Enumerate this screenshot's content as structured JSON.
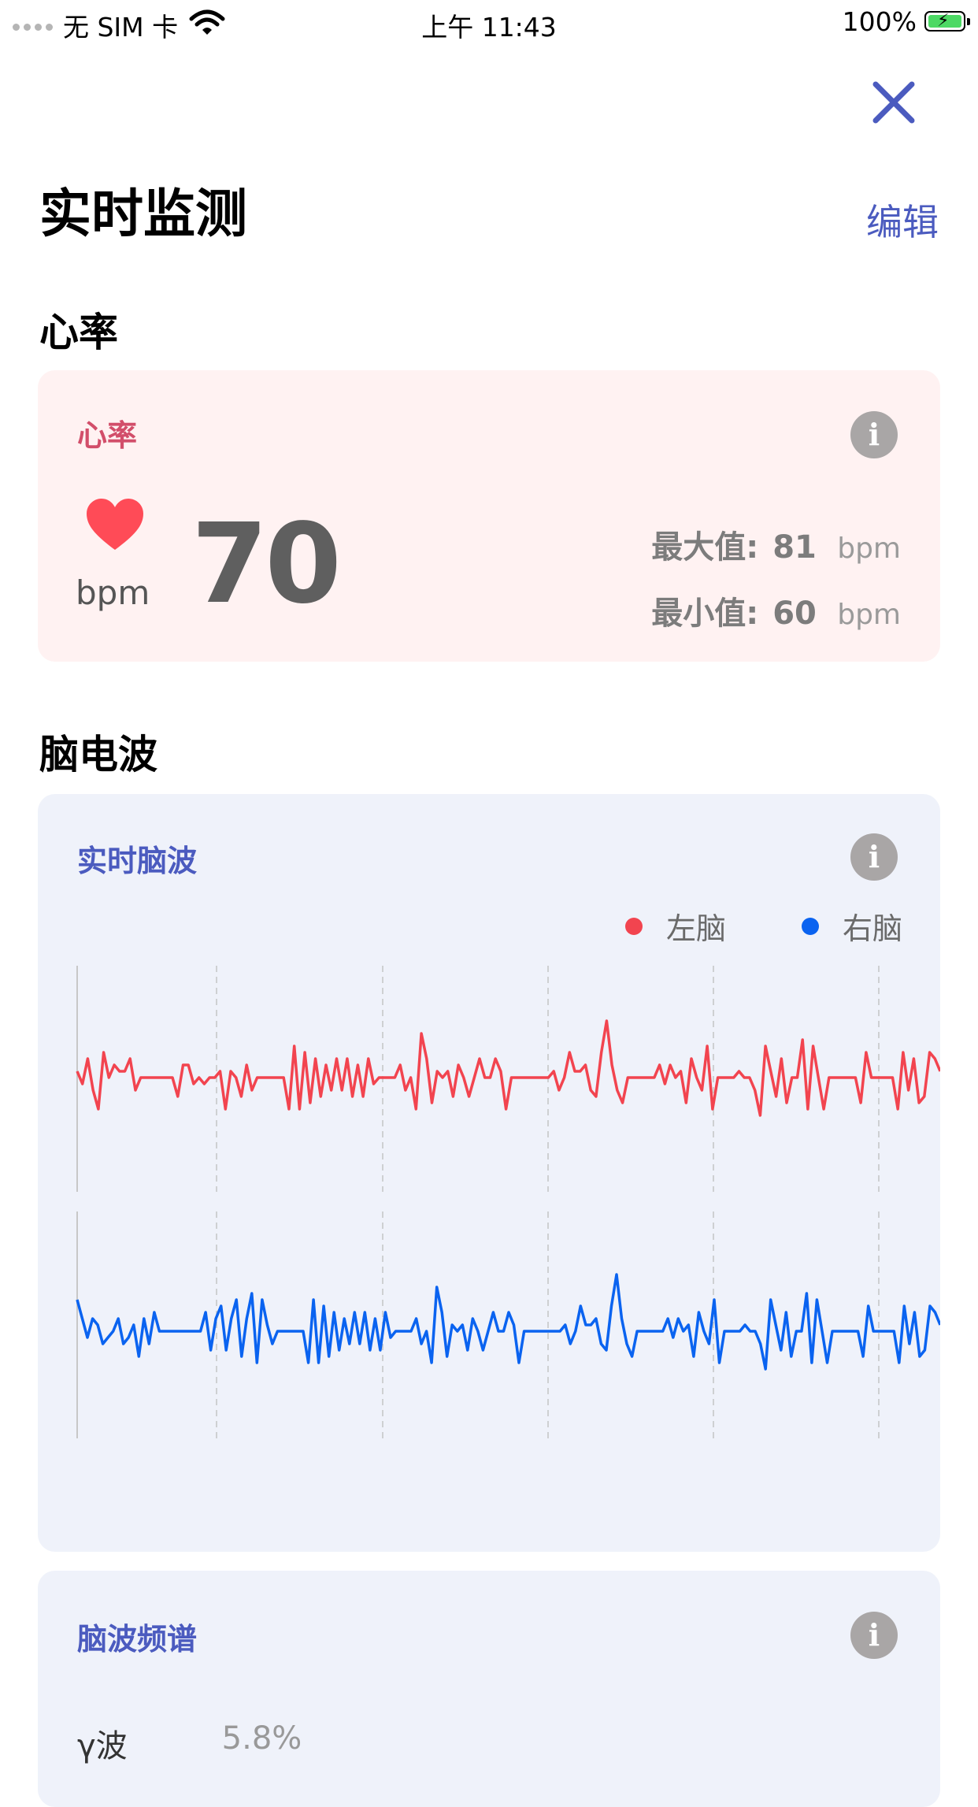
{
  "status_bar": {
    "carrier": "无 SIM 卡",
    "time": "上午 11:43",
    "battery": "100%"
  },
  "page": {
    "title": "实时监测",
    "edit_label": "编辑"
  },
  "heart_rate": {
    "section_title": "心率",
    "card_title": "心率",
    "value": "70",
    "unit": "bpm",
    "max_label": "最大值:",
    "max_value": "81",
    "max_unit": "bpm",
    "min_label": "最小值:",
    "min_value": "60",
    "min_unit": "bpm",
    "accent_color": "#d24e6a",
    "heart_color": "#ff4b57"
  },
  "eeg": {
    "section_title": "脑电波",
    "card_title": "实时脑波",
    "legend": [
      {
        "label": "左脑",
        "color": "#f2444f"
      },
      {
        "label": "右脑",
        "color": "#0a63f0"
      }
    ],
    "title_color": "#4b5bbf"
  },
  "spectrum": {
    "card_title": "脑波频谱",
    "first_row_label": "γ波",
    "first_row_value": "5.8%"
  },
  "chart_data": {
    "type": "line",
    "title": "实时脑波",
    "grid": true,
    "series": [
      {
        "name": "左脑",
        "color": "#f2444f",
        "values": [
          0.1,
          -0.1,
          0.3,
          -0.2,
          -0.5,
          0.4,
          0,
          0.2,
          0.1,
          0.1,
          0.3,
          -0.2,
          0,
          0,
          0,
          0,
          0,
          0,
          0,
          -0.3,
          0.2,
          0.2,
          -0.1,
          0,
          -0.1,
          0,
          0,
          0.1,
          -0.5,
          0.1,
          0,
          -0.3,
          0.2,
          -0.2,
          0,
          0,
          0,
          0,
          0,
          0,
          -0.5,
          0.5,
          -0.5,
          0.4,
          -0.4,
          0.3,
          -0.3,
          0.2,
          -0.2,
          0.3,
          -0.2,
          0.3,
          -0.3,
          0.2,
          -0.3,
          0.3,
          -0.1,
          0,
          0,
          0,
          0,
          0.2,
          -0.2,
          0,
          -0.5,
          0.7,
          0.3,
          -0.4,
          0.1,
          0,
          0.1,
          -0.3,
          0.2,
          0,
          -0.3,
          0,
          0.3,
          0,
          0,
          0.3,
          0.1,
          -0.5,
          0,
          0,
          0,
          0,
          0,
          0,
          0,
          0,
          0.1,
          -0.2,
          0,
          0.4,
          0.1,
          0.1,
          0.2,
          -0.2,
          -0.3,
          0.4,
          0.9,
          0.2,
          -0.2,
          -0.4,
          0,
          0,
          0,
          0,
          0,
          0,
          0.2,
          -0.1,
          0.2,
          0,
          0.1,
          -0.4,
          0.3,
          0,
          -0.2,
          0.5,
          -0.5,
          0,
          0,
          0,
          0,
          0.1,
          0,
          0,
          -0.2,
          -0.6,
          0.5,
          0.1,
          -0.3,
          0.3,
          -0.4,
          0,
          0,
          0.6,
          -0.5,
          0.5,
          0,
          -0.5,
          0,
          0,
          0,
          0,
          0,
          0,
          -0.4,
          0.4,
          0,
          0,
          0,
          0,
          0,
          -0.5,
          0.4,
          -0.2,
          0.3,
          -0.4,
          -0.3,
          0.4,
          0.3,
          0.1
        ]
      },
      {
        "name": "右脑",
        "color": "#0a63f0",
        "values": [
          0.5,
          0.2,
          -0.1,
          0.2,
          0.1,
          -0.2,
          -0.1,
          0,
          0.2,
          -0.2,
          -0.1,
          0.1,
          -0.4,
          0.2,
          -0.2,
          0.3,
          0,
          0,
          0,
          0,
          0,
          0,
          0,
          0,
          0,
          0.3,
          -0.3,
          0.2,
          0.4,
          -0.3,
          0.2,
          0.5,
          -0.4,
          0.2,
          0.6,
          -0.5,
          0.5,
          0.1,
          -0.2,
          0,
          0,
          0,
          0,
          0,
          0,
          -0.5,
          0.5,
          -0.5,
          0.4,
          -0.4,
          0.3,
          -0.3,
          0.2,
          -0.2,
          0.3,
          -0.2,
          0.3,
          -0.3,
          0.2,
          -0.3,
          0.3,
          -0.1,
          0,
          0,
          0,
          0,
          0.2,
          -0.2,
          0,
          -0.5,
          0.7,
          0.3,
          -0.4,
          0.1,
          0,
          0.1,
          -0.3,
          0.2,
          0,
          -0.3,
          0,
          0.3,
          0,
          0,
          0.3,
          0.1,
          -0.5,
          0,
          0,
          0,
          0,
          0,
          0,
          0,
          0,
          0.1,
          -0.2,
          0,
          0.4,
          0.1,
          0.1,
          0.2,
          -0.2,
          -0.3,
          0.4,
          0.9,
          0.2,
          -0.2,
          -0.4,
          0,
          0,
          0,
          0,
          0,
          0,
          0.2,
          -0.1,
          0.2,
          0,
          0.1,
          -0.4,
          0.3,
          0,
          -0.2,
          0.5,
          -0.5,
          0,
          0,
          0,
          0,
          0.1,
          0,
          0,
          -0.2,
          -0.6,
          0.5,
          0.1,
          -0.3,
          0.3,
          -0.4,
          0,
          0,
          0.6,
          -0.5,
          0.5,
          0,
          -0.5,
          0,
          0,
          0,
          0,
          0,
          0,
          -0.4,
          0.4,
          0,
          0,
          0,
          0,
          0,
          -0.5,
          0.4,
          -0.2,
          0.3,
          -0.4,
          -0.3,
          0.4,
          0.3,
          0.1
        ]
      }
    ]
  }
}
